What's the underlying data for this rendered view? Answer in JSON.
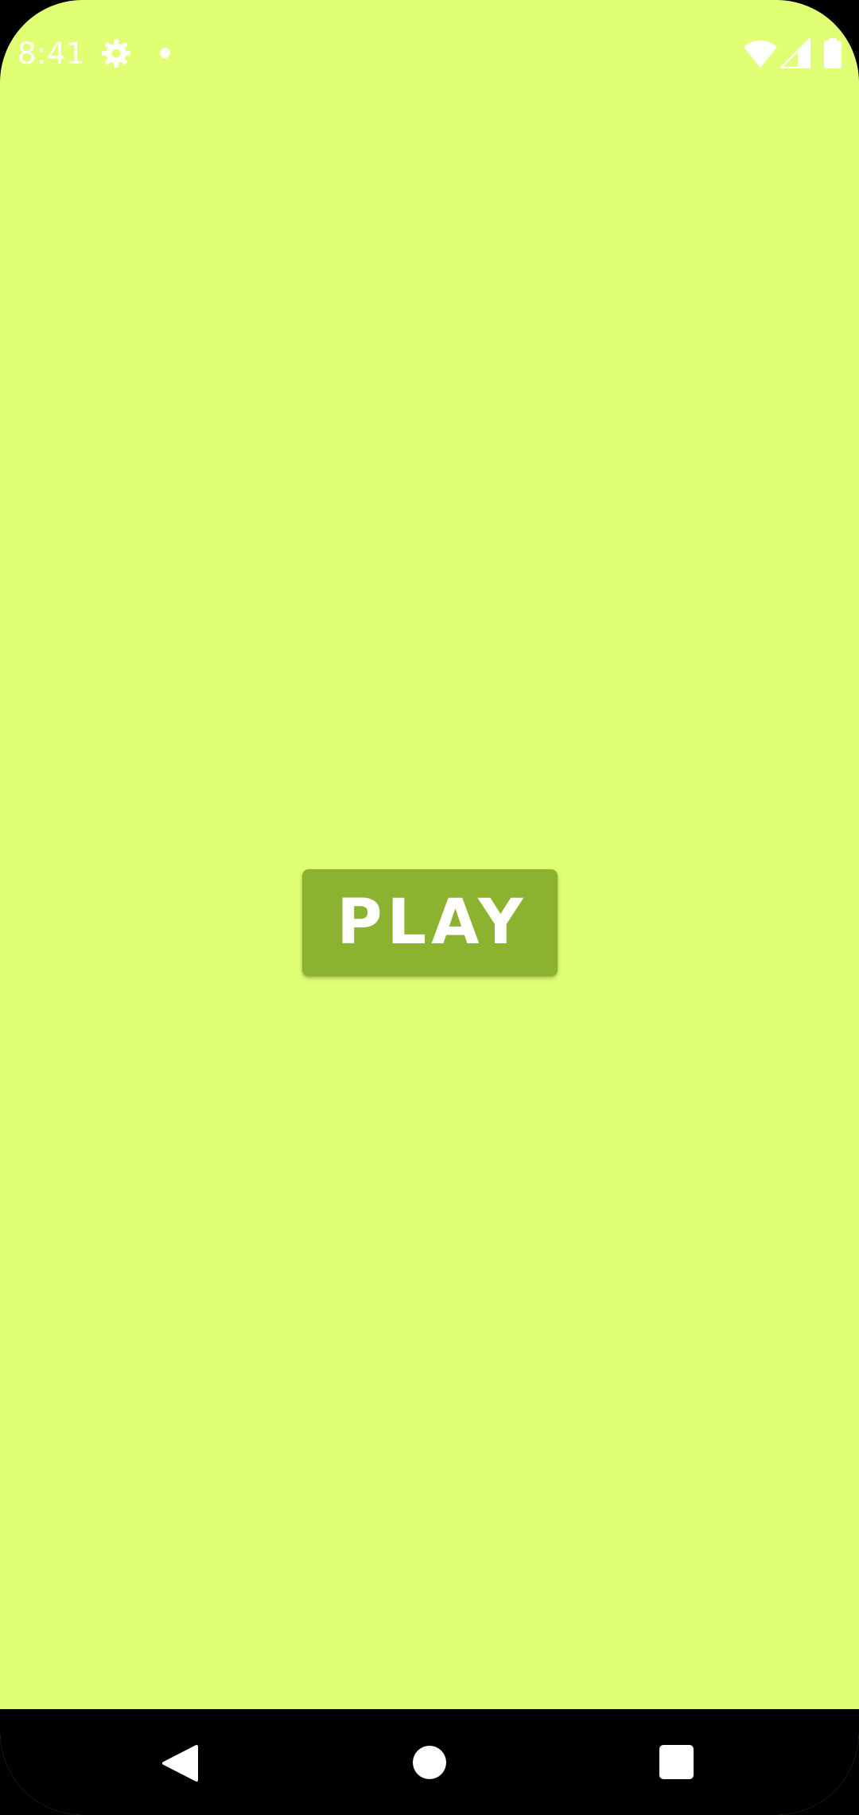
{
  "status_bar": {
    "time": "8:41",
    "icons": [
      "gear-icon",
      "dot-icon",
      "wifi-icon",
      "signal-icon",
      "battery-icon"
    ]
  },
  "main": {
    "play_label": "PLAY"
  },
  "nav_bar": {
    "icons": [
      "back-icon",
      "home-icon",
      "recents-icon"
    ]
  },
  "colors": {
    "background": "#e0ff74",
    "play_button": "#8cb32f",
    "status_icons": "#ffffff",
    "nav_bar": "#000000"
  }
}
